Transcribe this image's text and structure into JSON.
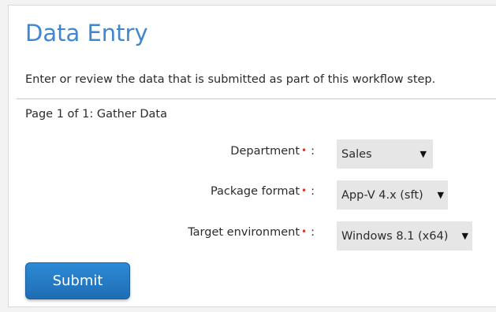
{
  "form": {
    "title": "Data Entry",
    "description": "Enter or review the data that is submitted as part of this workflow step.",
    "page_label": "Page 1 of 1: Gather Data",
    "required_marker": "•",
    "colon": ":",
    "fields": [
      {
        "label": "Department",
        "value": "Sales",
        "arrow": "▼"
      },
      {
        "label": "Package format",
        "value": "App-V 4.x (sft)",
        "arrow": "▼"
      },
      {
        "label": "Target environment",
        "value": "Windows 8.1 (x64)",
        "arrow": "▼"
      }
    ],
    "submit_label": "Submit"
  },
  "colors": {
    "title": "#3f87cf",
    "required": "#d9342b",
    "button": "#1f6db4",
    "select_bg": "#e6e6e6"
  }
}
